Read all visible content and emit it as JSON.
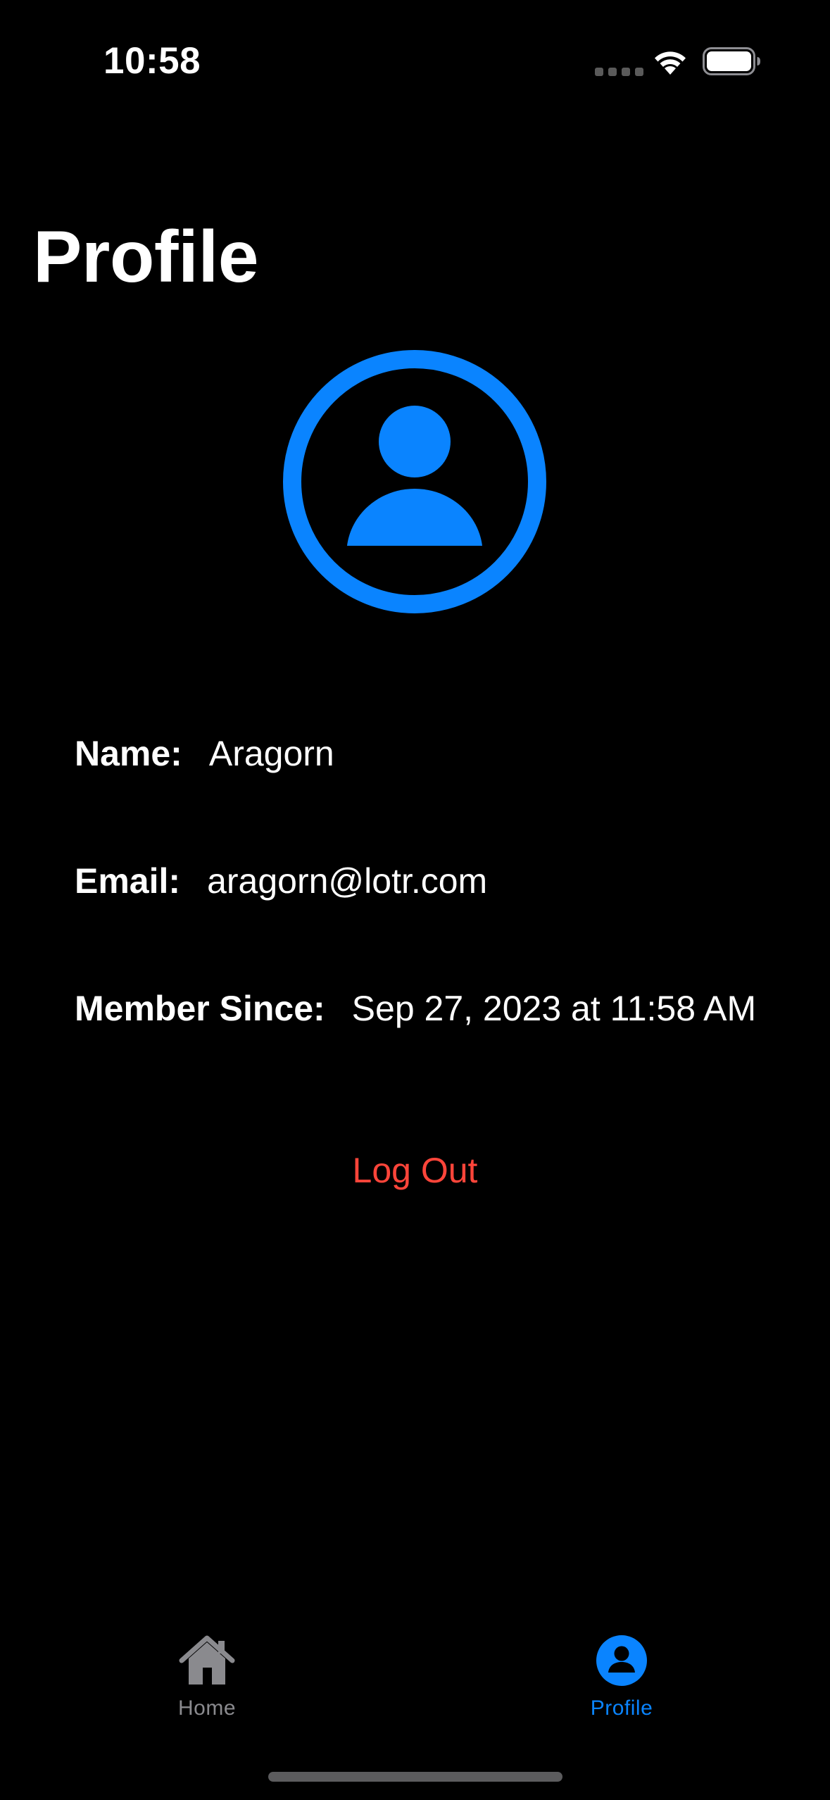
{
  "status_bar": {
    "time": "10:58",
    "icons": [
      "signal-icon",
      "wifi-icon",
      "battery-icon"
    ]
  },
  "page": {
    "title": "Profile"
  },
  "avatar": {
    "icon": "person-circle-icon",
    "color": "#0A84FF"
  },
  "profile": {
    "name_label": "Name:",
    "name_value": "Aragorn",
    "email_label": "Email:",
    "email_value": "aragorn@lotr.com",
    "since_label": "Member Since:",
    "since_value": "Sep 27, 2023 at 11:58 AM"
  },
  "actions": {
    "logout_label": "Log Out",
    "logout_color": "#FF453A"
  },
  "tab_bar": {
    "tabs": [
      {
        "label": "Home",
        "icon": "house-icon",
        "selected": false,
        "color": "#8A8A8E"
      },
      {
        "label": "Profile",
        "icon": "person-circle-icon",
        "selected": true,
        "color": "#0A84FF"
      }
    ]
  },
  "theme": {
    "background": "#000000",
    "text": "#FFFFFF",
    "accent": "#0A84FF"
  }
}
